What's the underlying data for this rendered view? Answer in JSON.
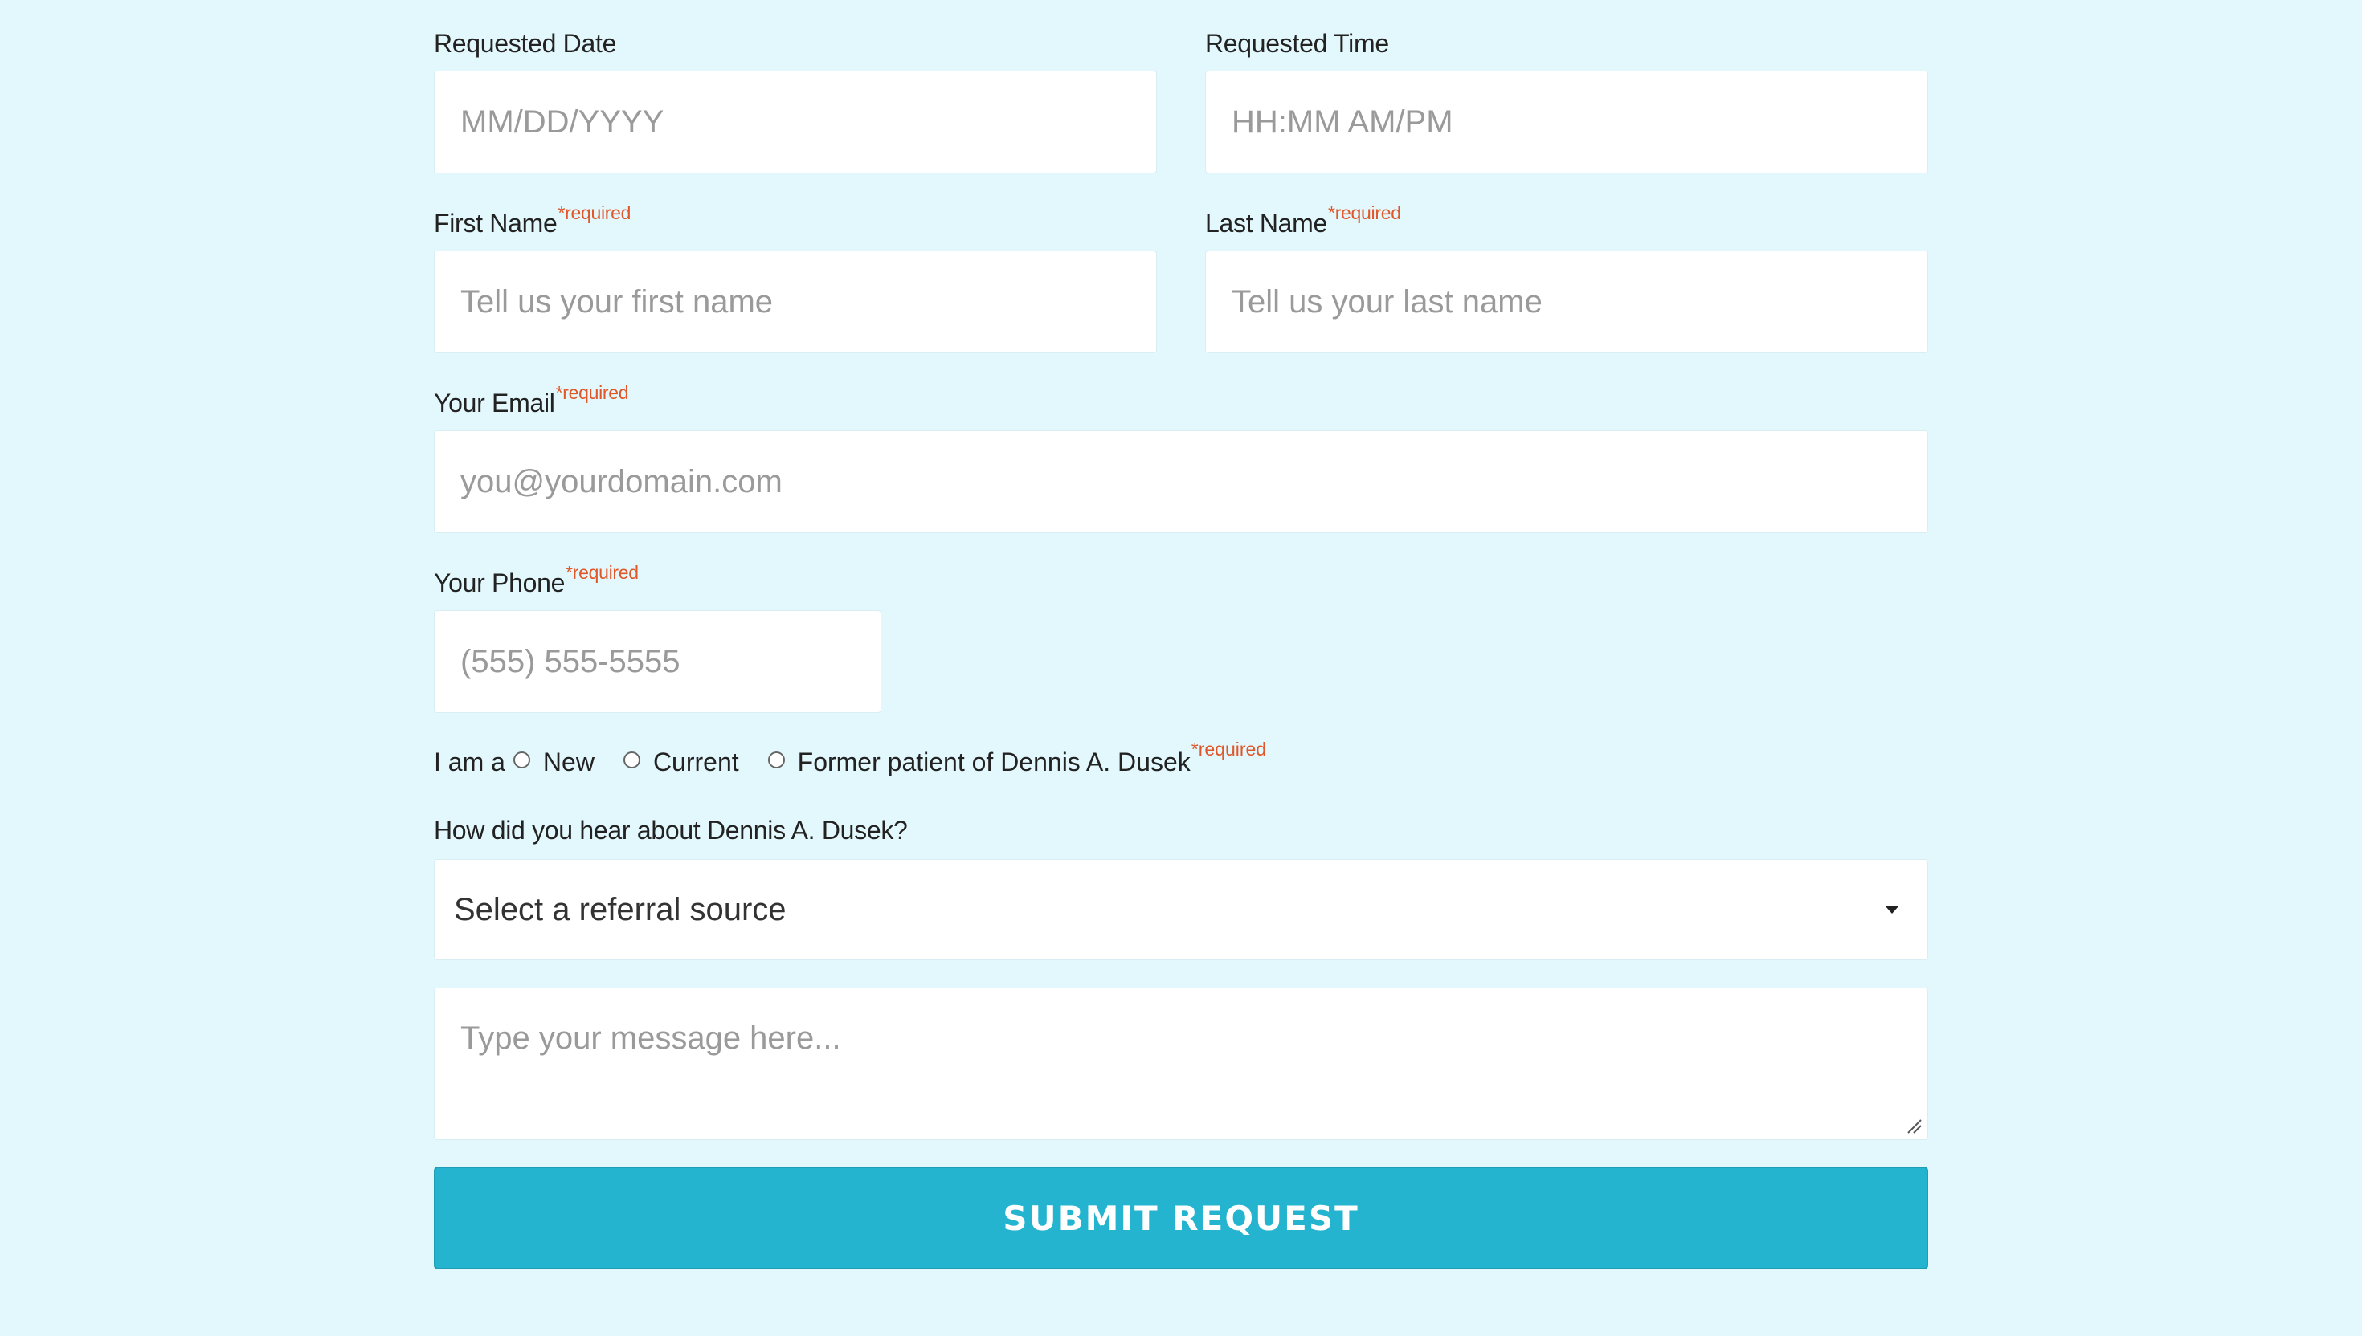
{
  "form": {
    "requested_date": {
      "label": "Requested Date",
      "placeholder": "MM/DD/YYYY"
    },
    "requested_time": {
      "label": "Requested Time",
      "placeholder": "HH:MM AM/PM"
    },
    "first_name": {
      "label": "First Name",
      "required": "*required",
      "placeholder": "Tell us your first name"
    },
    "last_name": {
      "label": "Last Name",
      "required": "*required",
      "placeholder": "Tell us your last name"
    },
    "email": {
      "label": "Your Email",
      "required": "*required",
      "placeholder": "you@yourdomain.com"
    },
    "phone": {
      "label": "Your Phone",
      "required": "*required",
      "placeholder": "(555) 555-5555"
    },
    "patient_status": {
      "prefix": "I am a",
      "options": [
        "New",
        "Current",
        "Former patient of Dennis A. Dusek"
      ],
      "required": "*required"
    },
    "referral": {
      "label": "How did you hear about Dennis A. Dusek?",
      "selected": "Select a referral source"
    },
    "message": {
      "placeholder": "Type your message here..."
    },
    "submit_label": "SUBMIT REQUEST"
  }
}
